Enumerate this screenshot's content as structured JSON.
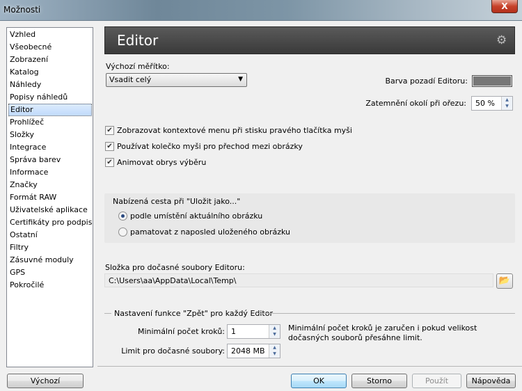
{
  "window": {
    "title": "Možnosti",
    "close_label": "X"
  },
  "sidebar": {
    "items": [
      {
        "label": "Vzhled"
      },
      {
        "label": "Všeobecné"
      },
      {
        "label": "Zobrazení"
      },
      {
        "label": "Katalog"
      },
      {
        "label": "Náhledy"
      },
      {
        "label": "Popisy náhledů"
      },
      {
        "label": "Editor",
        "selected": true
      },
      {
        "label": "Prohlížeč"
      },
      {
        "label": "Složky"
      },
      {
        "label": "Integrace"
      },
      {
        "label": "Správa barev"
      },
      {
        "label": "Informace"
      },
      {
        "label": "Značky"
      },
      {
        "label": "Formát RAW"
      },
      {
        "label": "Uživatelské aplikace"
      },
      {
        "label": "Certifikáty pro podpis"
      },
      {
        "label": "Ostatní"
      },
      {
        "label": "Filtry"
      },
      {
        "label": "Zásuvné moduly"
      },
      {
        "label": "GPS"
      },
      {
        "label": "Pokročilé"
      }
    ]
  },
  "header": {
    "title": "Editor",
    "icon": "gear-icon"
  },
  "zoom": {
    "label": "Výchozí měřítko:",
    "value": "Vsadit celý"
  },
  "bg_color": {
    "label": "Barva pozadí Editoru:",
    "color": "#777777"
  },
  "darken": {
    "label": "Zatemnění okolí při ořezu:",
    "value": "50 %"
  },
  "checkboxes": [
    {
      "label": "Zobrazovat kontextové menu při stisku pravého tlačítka myši",
      "checked": true
    },
    {
      "label": "Používat kolečko myši pro přechod mezi obrázky",
      "checked": true
    },
    {
      "label": "Animovat obrys výběru",
      "checked": true
    }
  ],
  "save_path": {
    "title": "Nabízená cesta při \"Uložit jako...\"",
    "options": [
      {
        "label": "podle umístění aktuálního obrázku",
        "selected": true
      },
      {
        "label": "pamatovat z naposled uloženého obrázku",
        "selected": false
      }
    ]
  },
  "temp_folder": {
    "label": "Složka pro dočasné soubory Editoru:",
    "value": "C:\\Users\\aa\\AppData\\Local\\Temp\\"
  },
  "undo": {
    "title": "Nastavení funkce \"Zpět\" pro každý Editor",
    "min_steps_label": "Minimální počet kroků:",
    "min_steps": "1",
    "limit_label": "Limit pro dočasné soubory:",
    "limit": "2048 MB",
    "note": "Minimální počet kroků je zaručen i pokud velikost dočasných souborů přesáhne limit."
  },
  "buttons": {
    "default": "Výchozí",
    "ok": "OK",
    "cancel": "Storno",
    "apply": "Použít",
    "help": "Nápověda"
  }
}
